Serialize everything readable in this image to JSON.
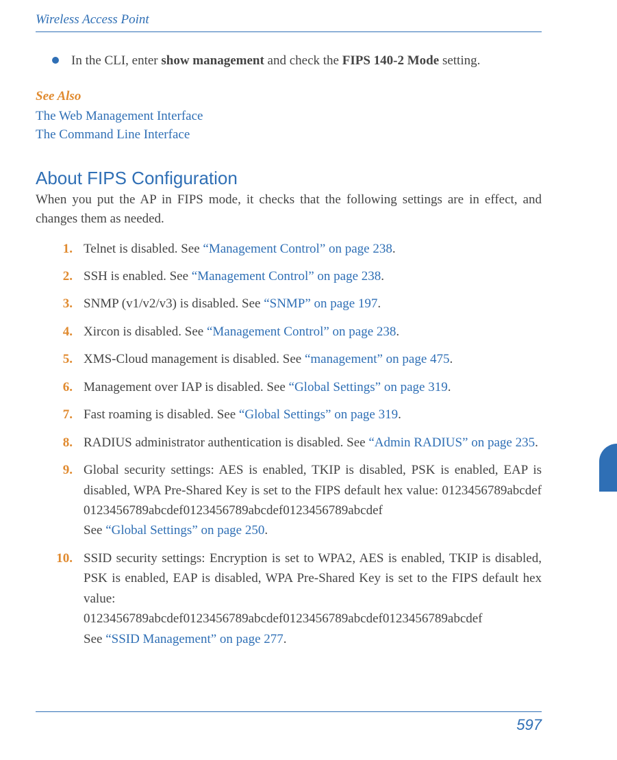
{
  "running_head": "Wireless Access Point",
  "bullet": {
    "pre": "In the CLI, enter ",
    "cmd": "show management",
    "mid": " and check the ",
    "mode": "FIPS 140-2 Mode",
    "post": " setting."
  },
  "see_also_label": "See Also",
  "see_also_links": [
    "The Web Management Interface",
    "The Command Line Interface"
  ],
  "section_title": "About FIPS Configuration",
  "intro": "When you put the AP in FIPS mode, it checks that the following settings are in effect, and changes them as needed.",
  "items": [
    {
      "n": "1.",
      "pre": "Telnet is disabled. See ",
      "xref": "“Management Control” on page 238",
      "post": "."
    },
    {
      "n": "2.",
      "pre": "SSH is enabled. See ",
      "xref": "“Management Control” on page 238",
      "post": "."
    },
    {
      "n": "3.",
      "pre": "SNMP (v1/v2/v3) is disabled. See ",
      "xref": "“SNMP” on page 197",
      "post": "."
    },
    {
      "n": "4.",
      "pre": "Xircon is disabled. See ",
      "xref": "“Management Control” on page 238",
      "post": "."
    },
    {
      "n": "5.",
      "pre": "XMS-Cloud management is disabled. See ",
      "xref": "“management” on page 475",
      "post": "."
    },
    {
      "n": "6.",
      "pre": "Management over IAP is disabled. See ",
      "xref": "“Global Settings” on page 319",
      "post": "."
    },
    {
      "n": "7.",
      "pre": "Fast roaming is disabled. See ",
      "xref": "“Global Settings” on page 319",
      "post": "."
    },
    {
      "n": "8.",
      "pre": "RADIUS administrator authentication is disabled. See ",
      "xref": "“Admin RADIUS” on page 235",
      "post": "."
    },
    {
      "n": "9.",
      "pre": "Global security settings: AES is enabled, TKIP is disabled, PSK is enabled, EAP is disabled, WPA Pre-Shared Key is set to the FIPS default hex value: ",
      "hex": "0123456789abcdef0123456789abcdef0123456789abcdef0123456789abcdef",
      "see": "See ",
      "xref": "“Global Settings” on page 250",
      "post": "."
    },
    {
      "n": "10.",
      "pre": "SSID security settings: Encryption is set to WPA2, AES is enabled, TKIP is disabled, PSK is enabled, EAP is disabled, WPA Pre-Shared Key is set to the FIPS default hex value:",
      "hex": "0123456789abcdef0123456789abcdef0123456789abcdef0123456789abcdef",
      "see": "See ",
      "xref": "“SSID Management” on page 277",
      "post": "."
    }
  ],
  "page_number": "597"
}
